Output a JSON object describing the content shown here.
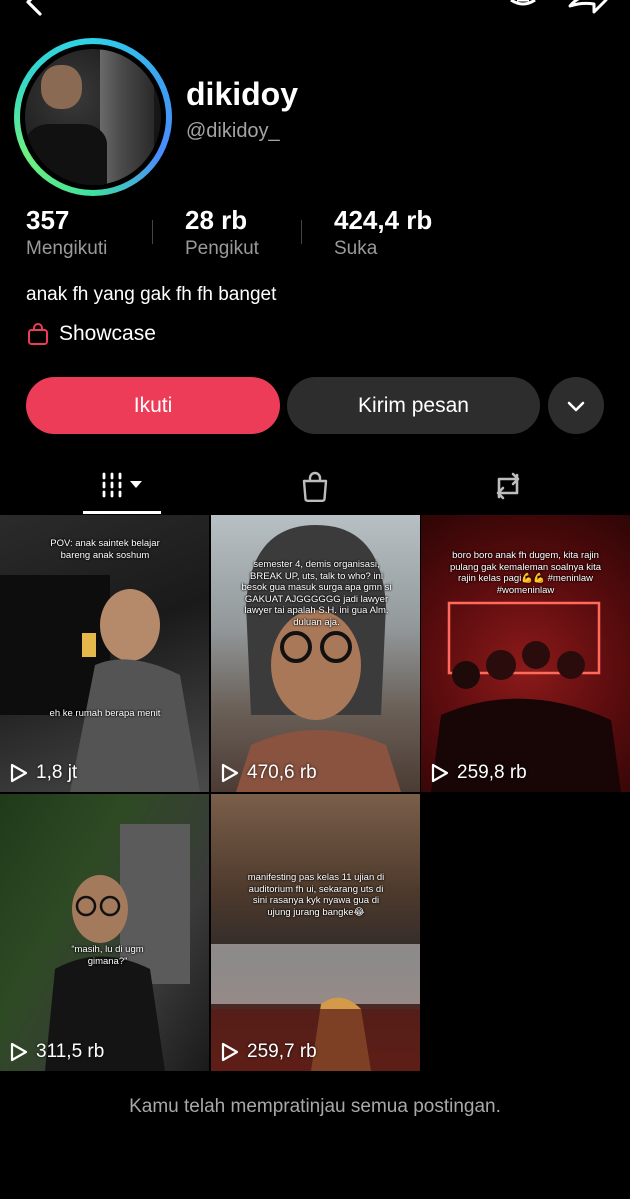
{
  "profile": {
    "display_name": "dikidoy",
    "username": "@dikidoy_",
    "bio": "anak fh yang gak fh fh banget",
    "showcase_label": "Showcase"
  },
  "stats": [
    {
      "value": "357",
      "label": "Mengikuti"
    },
    {
      "value": "28 rb",
      "label": "Pengikut"
    },
    {
      "value": "424,4 rb",
      "label": "Suka"
    }
  ],
  "actions": {
    "follow_label": "Ikuti",
    "message_label": "Kirim pesan"
  },
  "tabs": [
    {
      "icon": "grid-icon",
      "active": true
    },
    {
      "icon": "shopping-bag-icon",
      "active": false
    },
    {
      "icon": "repost-icon",
      "active": false
    }
  ],
  "videos": [
    {
      "views": "1,8 jt",
      "caption_top": "POV: anak saintek belajar bareng anak soshum",
      "caption_mid": "eh ke rumah berapa menit"
    },
    {
      "views": "470,6 rb",
      "caption_top": "semester 4, demis organisasi, BREAK UP, uts, talk to who? ini besok gua masuk surga apa gmn si GAKUAT AJGGGGGG jadi lawyer lawyer tai apalah S.H. ini gua Alm. duluan aja."
    },
    {
      "views": "259,8 rb",
      "caption_top": "boro boro anak fh dugem, kita rajin pulang gak kemaleman soalnya kita rajin kelas pagi💪💪 #meninlaw #womeninlaw"
    },
    {
      "views": "311,5 rb",
      "caption_top": "“masih, lu di ugm gimana?”"
    },
    {
      "views": "259,7 rb",
      "caption_top": "manifesting pas kelas 11 ujian di auditorium fh ui, sekarang uts di sini rasanya kyk nyawa gua di ujung jurang bangke😂"
    }
  ],
  "footer_note": "Kamu telah mempratinjau semua postingan.",
  "colors": {
    "background": "#000000",
    "follow_button": "#ed3c58",
    "secondary_button": "#2d2d2d",
    "muted_text": "#9a9a9a"
  }
}
